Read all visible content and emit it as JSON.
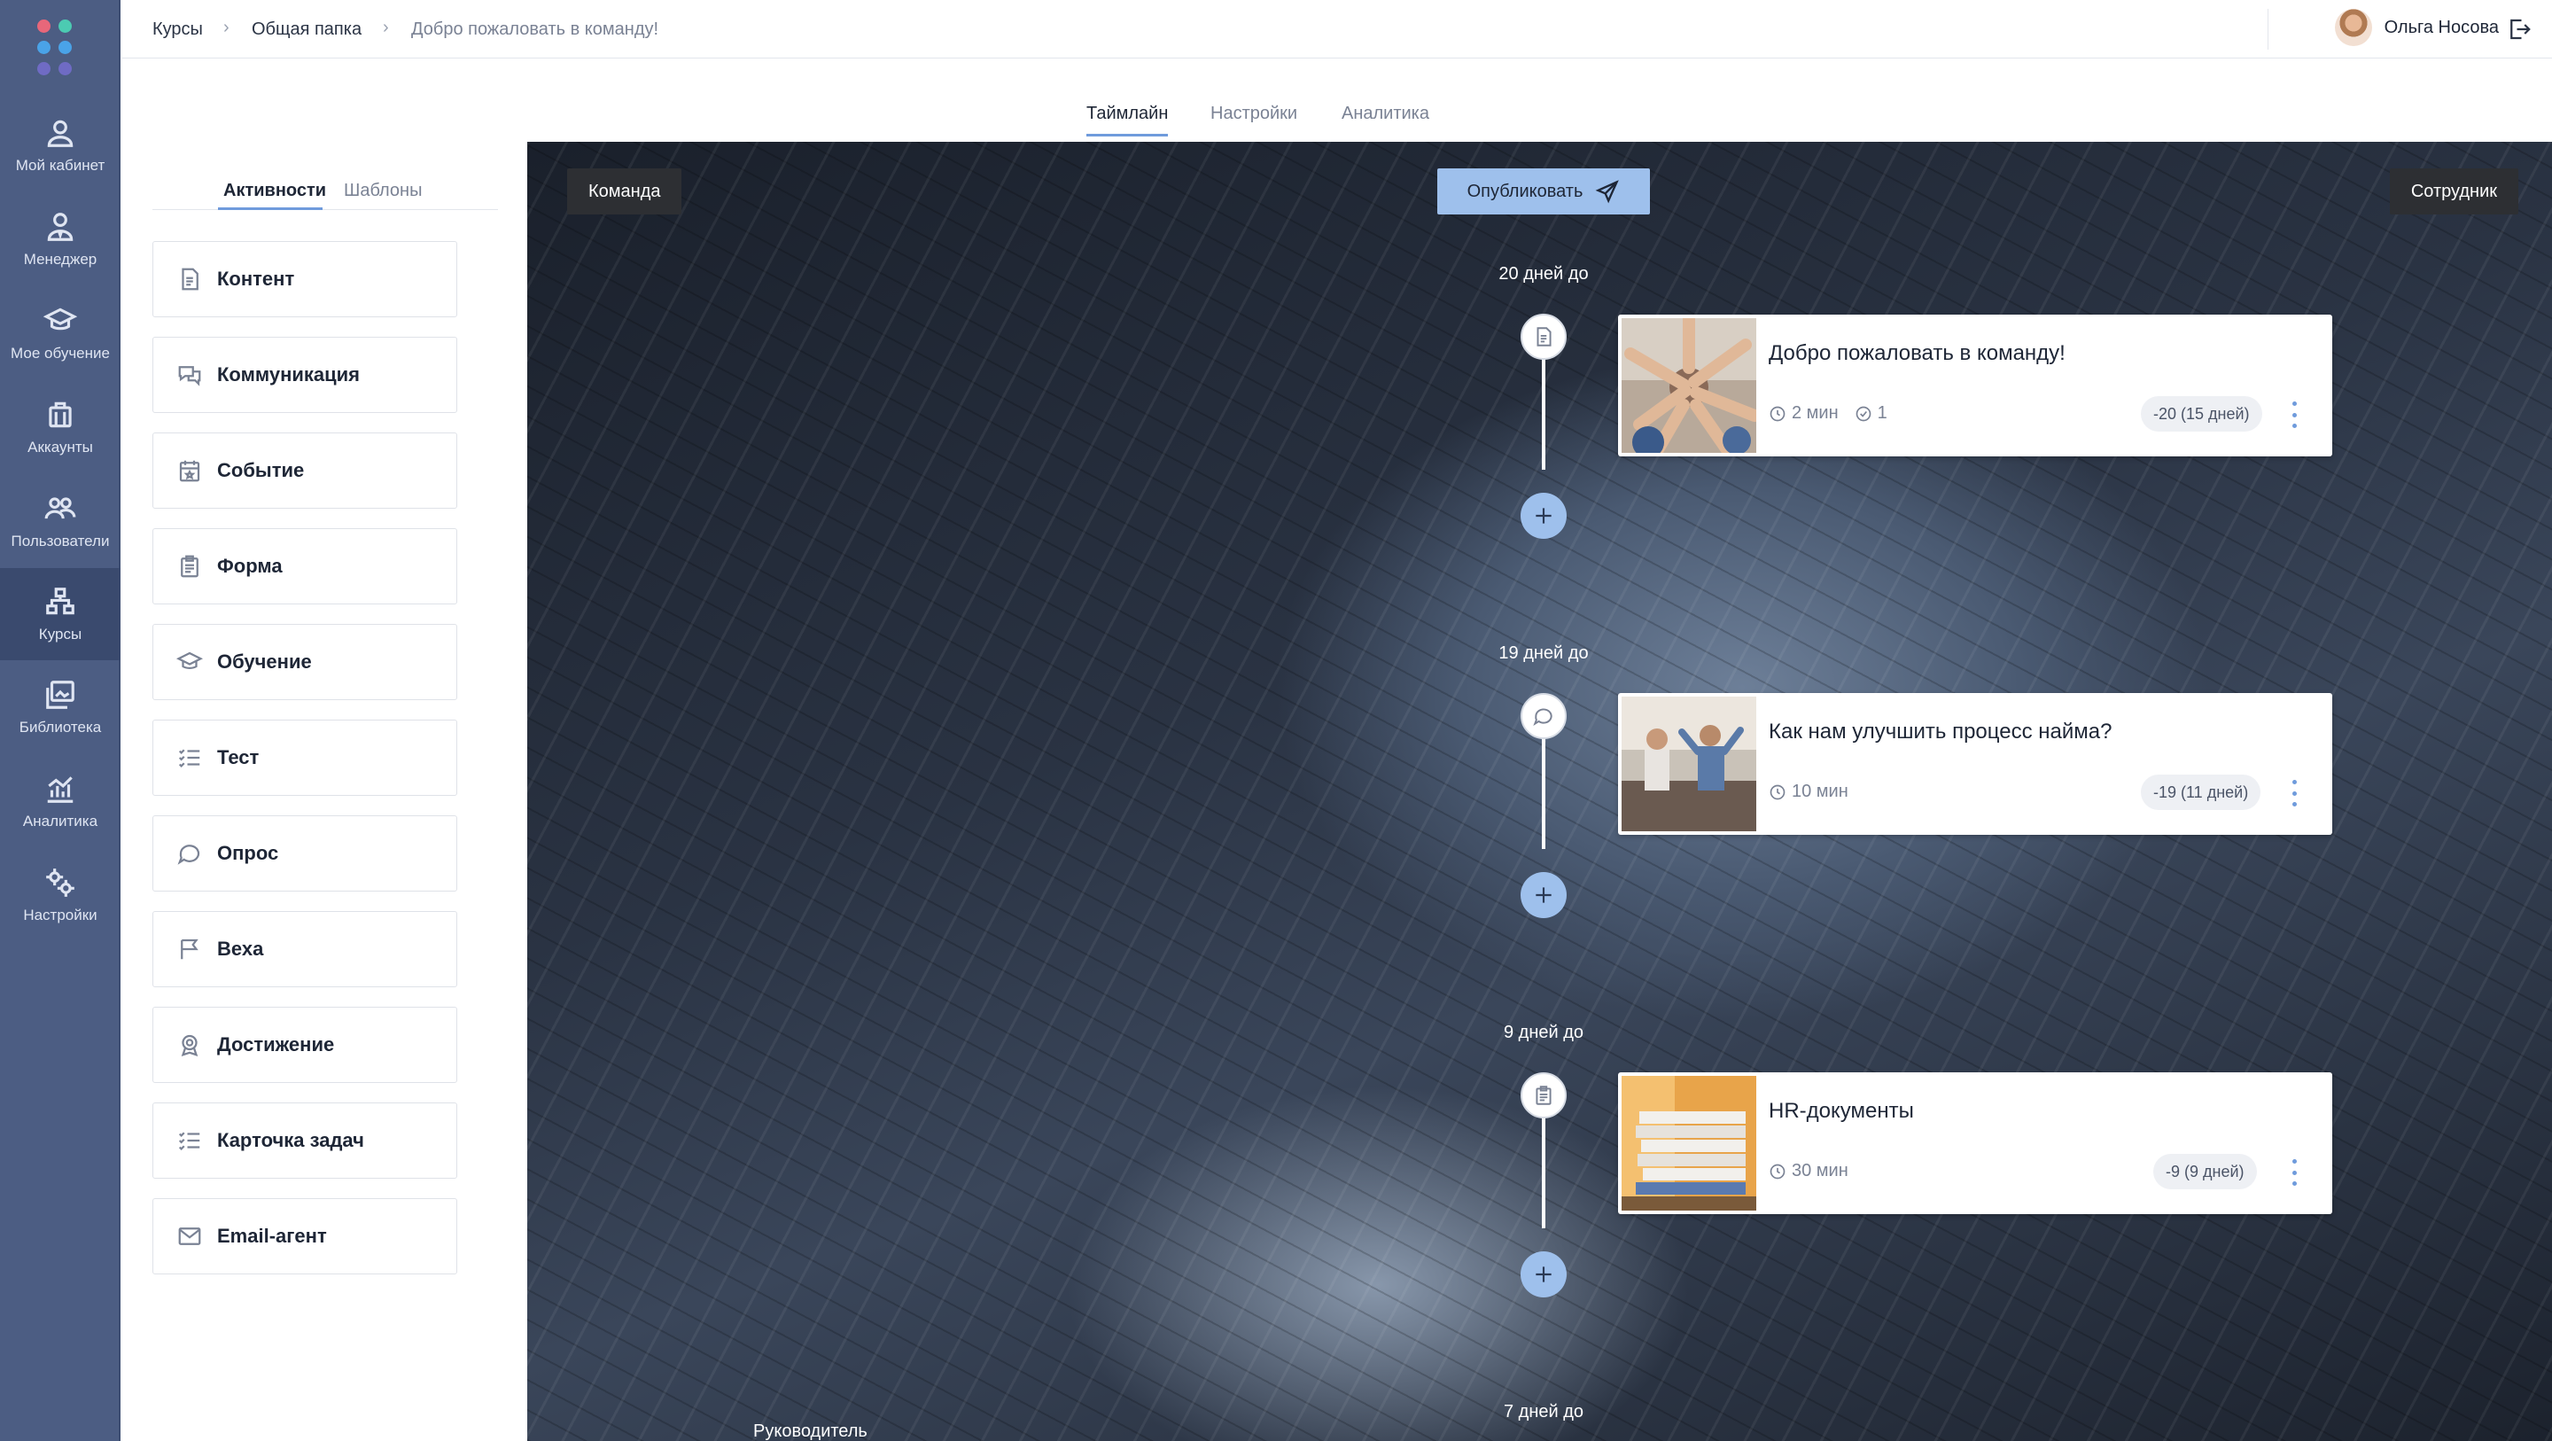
{
  "nav": {
    "items": [
      {
        "label": "Мой кабинет",
        "icon": "user-icon"
      },
      {
        "label": "Менеджер",
        "icon": "manager-icon"
      },
      {
        "label": "Мое обучение",
        "icon": "graduation-cap-icon"
      },
      {
        "label": "Аккаунты",
        "icon": "briefcase-icon"
      },
      {
        "label": "Пользователи",
        "icon": "users-icon"
      },
      {
        "label": "Курсы",
        "icon": "courses-icon"
      },
      {
        "label": "Библиотека",
        "icon": "library-icon"
      },
      {
        "label": "Аналитика",
        "icon": "analytics-icon"
      },
      {
        "label": "Настройки",
        "icon": "settings-icon"
      }
    ],
    "active": "Курсы",
    "logo_colors": [
      "#e8677a",
      "#4ccbb2",
      "#4aa3e8",
      "#4aa3e8",
      "#6f6bc4",
      "#6f6bc4"
    ]
  },
  "header": {
    "breadcrumbs": [
      "Курсы",
      "Общая папка",
      "Добро пожаловать в команду!"
    ],
    "user_name": "Ольга Носова"
  },
  "tabs": [
    "Таймлайн",
    "Настройки",
    "Аналитика"
  ],
  "panel": {
    "tabs": [
      "Активности",
      "Шаблоны"
    ],
    "activities": [
      {
        "label": "Контент",
        "icon": "document-icon"
      },
      {
        "label": "Коммуникация",
        "icon": "chat-icon"
      },
      {
        "label": "Событие",
        "icon": "calendar-icon"
      },
      {
        "label": "Форма",
        "icon": "clipboard-icon"
      },
      {
        "label": "Обучение",
        "icon": "graduation-cap-icon"
      },
      {
        "label": "Тест",
        "icon": "checklist-icon"
      },
      {
        "label": "Опрос",
        "icon": "poll-icon"
      },
      {
        "label": "Веха",
        "icon": "flag-icon"
      },
      {
        "label": "Достижение",
        "icon": "award-icon"
      },
      {
        "label": "Карточка задач",
        "icon": "task-list-icon"
      },
      {
        "label": "Email-агент",
        "icon": "mail-icon"
      }
    ]
  },
  "timeline": {
    "left_button": "Команда",
    "publish_button": "Опубликовать",
    "right_button": "Сотрудник",
    "bottom_label": "Руководитель",
    "days": [
      "20 дней до",
      "19 дней до",
      "9 дней до",
      "7 дней до"
    ],
    "cards": [
      {
        "title": "Добро пожаловать в команду!",
        "duration": "2 мин",
        "count": "1",
        "badge": "-20 (15 дней)",
        "node_icon": "document-icon"
      },
      {
        "title": "Как нам улучшить процесс найма?",
        "duration": "10 мин",
        "count": "",
        "badge": "-19 (11 дней)",
        "node_icon": "chat-icon"
      },
      {
        "title": "HR-документы",
        "duration": "30 мин",
        "count": "",
        "badge": "-9 (9 дней)",
        "node_icon": "clipboard-icon"
      }
    ]
  }
}
